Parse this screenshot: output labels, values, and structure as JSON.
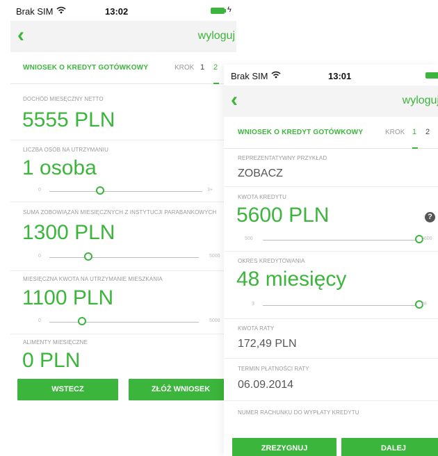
{
  "screen_step2": {
    "status": {
      "carrier": "Brak SIM",
      "time": "13:02"
    },
    "nav": {
      "logout": "wyloguj"
    },
    "header": {
      "title": "WNIOSEK O KREDYT GOTÓWKOWY",
      "krok": "KROK",
      "step1": "1",
      "step2": "2"
    },
    "fields": {
      "income": {
        "label": "DOCHÓD MIESĘCZNY NETTO",
        "value": "5555 PLN"
      },
      "dependents": {
        "label": "LICZBA OSÓB NA UTRZYMANIU",
        "value": "1 osoba",
        "min": "0",
        "max": "3+",
        "level": 0.33
      },
      "obligations": {
        "label": "SUMA ZOBOWIĄZAŃ MIESIĘCZNYCH Z INSTYTUCJI PARABANKOWYCH",
        "value": "1300 PLN",
        "min": "0",
        "max": "5000",
        "level": 0.26
      },
      "housing": {
        "label": "MIESIĘCZNA KWOTA NA UTRZYMANIE MIESZKANIA",
        "value": "1100 PLN",
        "min": "0",
        "max": "5000",
        "level": 0.22
      },
      "alimony": {
        "label": "ALIMENTY MIESIĘCZNE",
        "value": "0 PLN"
      }
    },
    "buttons": {
      "back": "WSTECZ",
      "submit": "ZŁÓŻ WNIOSEK"
    }
  },
  "screen_step1": {
    "status": {
      "carrier": "Brak SIM",
      "time": "13:01"
    },
    "nav": {
      "logout": "wyloguj"
    },
    "header": {
      "title": "WNIOSEK O KREDYT GOTÓWKOWY",
      "krok": "KROK",
      "step1": "1",
      "step2": "2"
    },
    "fields": {
      "example": {
        "label": "REPREZENTATYWNY PRZYKŁAD",
        "value": "ZOBACZ"
      },
      "amount": {
        "label": "KWOTA KREDYTU",
        "value": "5600 PLN",
        "min": "500",
        "max": "5600",
        "level": 1.0,
        "help": "?"
      },
      "period": {
        "label": "OKRES KREDYTOWANIA",
        "value": "48 miesięcy",
        "min": "3",
        "max": "48",
        "level": 1.0
      },
      "installment": {
        "label": "KWOTA RATY",
        "value": "172,49 PLN"
      },
      "due_date": {
        "label": "TERMIN PŁATNOŚCI RATY",
        "value": "06.09.2014"
      },
      "account": {
        "label": "NUMER RACHUNKU DO WYPŁATY KREDYTU"
      }
    },
    "buttons": {
      "resign": "ZREZYGNUJ",
      "next": "DALEJ"
    }
  }
}
